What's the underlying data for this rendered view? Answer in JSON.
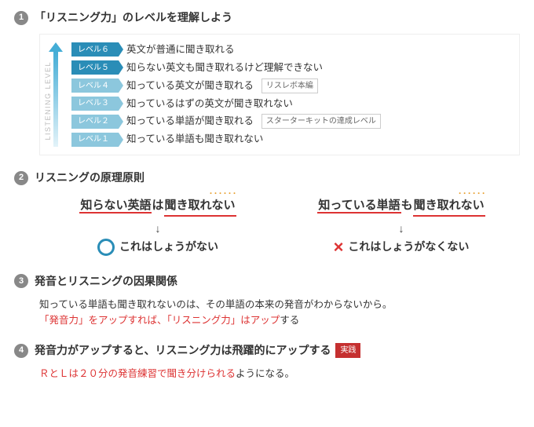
{
  "sections": {
    "s1": {
      "num": "1",
      "title": "「リスニング力」のレベルを理解しよう"
    },
    "s2": {
      "num": "2",
      "title": "リスニングの原理原則"
    },
    "s3": {
      "num": "3",
      "title": "発音とリスニングの因果関係"
    },
    "s4": {
      "num": "4",
      "title": "発音力がアップすると、リスニング力は飛躍的にアップする"
    }
  },
  "arrow_label": "LISTENING LEVEL",
  "levels": {
    "l6": {
      "label": "レベル６",
      "text": "英文が普通に聞き取れる",
      "note": ""
    },
    "l5": {
      "label": "レベル５",
      "text": "知らない英文も聞き取れるけど理解できない",
      "note": ""
    },
    "l4": {
      "label": "レベル４",
      "text": "知っている英文が聞き取れる",
      "note": "リスレボ本編"
    },
    "l3": {
      "label": "レベル３",
      "text": "知っているはずの英文が聞き取れない",
      "note": ""
    },
    "l2": {
      "label": "レベル２",
      "text": "知っている単語が聞き取れる",
      "note": "スターターキットの達成レベル"
    },
    "l1": {
      "label": "レベル１",
      "text": "知っている単語も聞き取れない",
      "note": ""
    }
  },
  "principle_left": {
    "a": "知らない英語",
    "b": "は",
    "c": "聞き取れない",
    "result": "これはしょうがない"
  },
  "principle_right": {
    "a": "知っている単語",
    "b": "も",
    "c": "聞き取れない",
    "result": "これはしょうがなくない"
  },
  "arrow_down": "↓",
  "s3_body": {
    "line1": "知っている単語も聞き取れないのは、その単語の本来の発音がわからないから。",
    "line2a": "「発音力」をアップすれば、「リスニング力」はアップ",
    "line2b": "する"
  },
  "s4_tag": "実践",
  "s4_body": {
    "a": "ＲとＬは２０分の発音練習で聞き分けられる",
    "b": "ようになる。"
  }
}
